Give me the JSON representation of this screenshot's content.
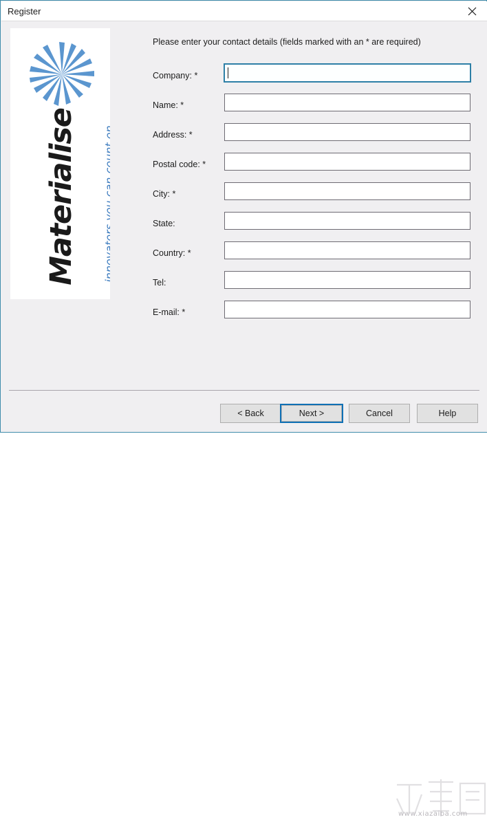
{
  "window": {
    "title": "Register",
    "close_icon": "close-icon"
  },
  "logo": {
    "brand": "Materialise",
    "tagline": "innovators you can count on",
    "burst_icon": "starburst-icon",
    "brand_color": "#1a1a1a",
    "accent_color": "#3f7dbf"
  },
  "main": {
    "instruction": "Please enter your contact details (fields marked with an * are required)",
    "fields": [
      {
        "label": "Company: *",
        "value": "",
        "placeholder": "",
        "focused": true
      },
      {
        "label": "Name: *",
        "value": "",
        "placeholder": "",
        "focused": false
      },
      {
        "label": "Address: *",
        "value": "",
        "placeholder": "",
        "focused": false
      },
      {
        "label": "Postal code: *",
        "value": "",
        "placeholder": "",
        "focused": false
      },
      {
        "label": "City: *",
        "value": "",
        "placeholder": "",
        "focused": false
      },
      {
        "label": "State:",
        "value": "",
        "placeholder": "",
        "focused": false
      },
      {
        "label": "Country: *",
        "value": "",
        "placeholder": "",
        "focused": false
      },
      {
        "label": "Tel:",
        "value": "",
        "placeholder": "",
        "focused": false
      },
      {
        "label": "E-mail: *",
        "value": "",
        "placeholder": "",
        "focused": false
      }
    ]
  },
  "footer": {
    "back_label": "< Back",
    "next_label": "Next >",
    "cancel_label": "Cancel",
    "help_label": "Help",
    "default_button": "Next >",
    "default_border_color": "#0f70b5"
  },
  "watermark": {
    "url": "www.xiazaiba.com",
    "glyphs": "下载吧"
  }
}
